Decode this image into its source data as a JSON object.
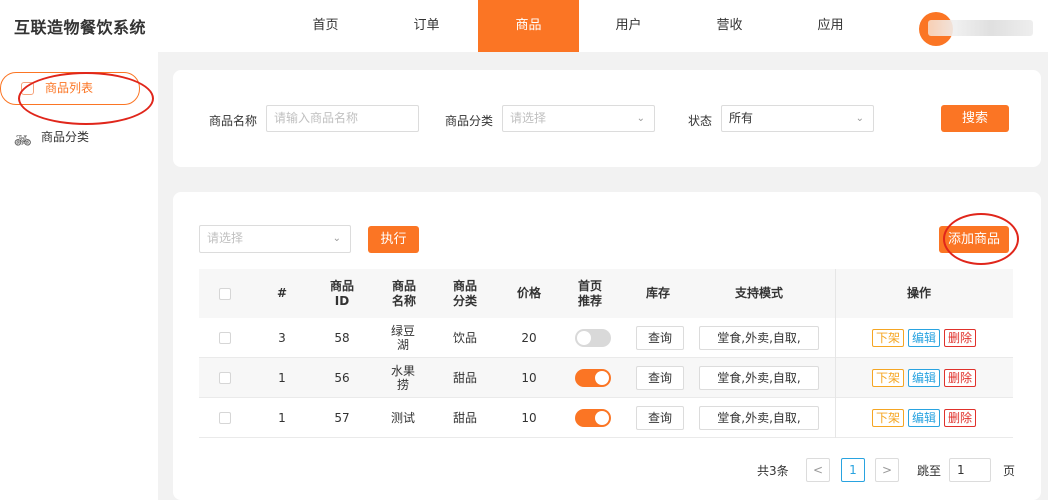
{
  "app": {
    "title": "互联造物餐饮系统"
  },
  "nav": {
    "items": [
      {
        "label": "首页"
      },
      {
        "label": "订单"
      },
      {
        "label": "商品"
      },
      {
        "label": "用户"
      },
      {
        "label": "营收"
      },
      {
        "label": "应用"
      }
    ],
    "active_index": 2
  },
  "sidebar": {
    "items": [
      {
        "label": "商品列表",
        "icon": "tag-icon",
        "active": true
      },
      {
        "label": "商品分类",
        "icon": "bike-icon",
        "active": false
      }
    ]
  },
  "filters": {
    "name_label": "商品名称",
    "name_placeholder": "请输入商品名称",
    "category_label": "商品分类",
    "category_placeholder": "请选择",
    "status_label": "状态",
    "status_value": "所有",
    "search_label": "搜索"
  },
  "bulk": {
    "select_placeholder": "请选择",
    "execute_label": "执行",
    "add_label": "添加商品"
  },
  "table": {
    "headers": [
      "#",
      "商品ID",
      "商品名称",
      "商品分类",
      "价格",
      "首页推荐",
      "库存",
      "支持模式",
      "操作"
    ],
    "rows": [
      {
        "index": "3",
        "id": "58",
        "name": "绿豆湖",
        "category": "饮品",
        "price": "20",
        "featured": false,
        "stock_label": "查询",
        "modes": "堂食,外卖,自取,",
        "actions": [
          "下架",
          "编辑",
          "删除"
        ]
      },
      {
        "index": "1",
        "id": "56",
        "name": "水果捞",
        "category": "甜品",
        "price": "10",
        "featured": true,
        "stock_label": "查询",
        "modes": "堂食,外卖,自取,",
        "actions": [
          "下架",
          "编辑",
          "删除"
        ]
      },
      {
        "index": "1",
        "id": "57",
        "name": "测试",
        "category": "甜品",
        "price": "10",
        "featured": true,
        "stock_label": "查询",
        "modes": "堂食,外卖,自取,",
        "actions": [
          "下架",
          "编辑",
          "删除"
        ]
      }
    ]
  },
  "pagination": {
    "total_text": "共3条",
    "prev": "<",
    "current": "1",
    "next": ">",
    "goto_label": "跳至",
    "goto_value": "1",
    "page_suffix": "页"
  },
  "colors": {
    "accent": "#fb7524",
    "edit": "#29a3e0",
    "delete": "#e0312b",
    "offshelf": "#f5a623",
    "annotation": "#e0261b"
  }
}
